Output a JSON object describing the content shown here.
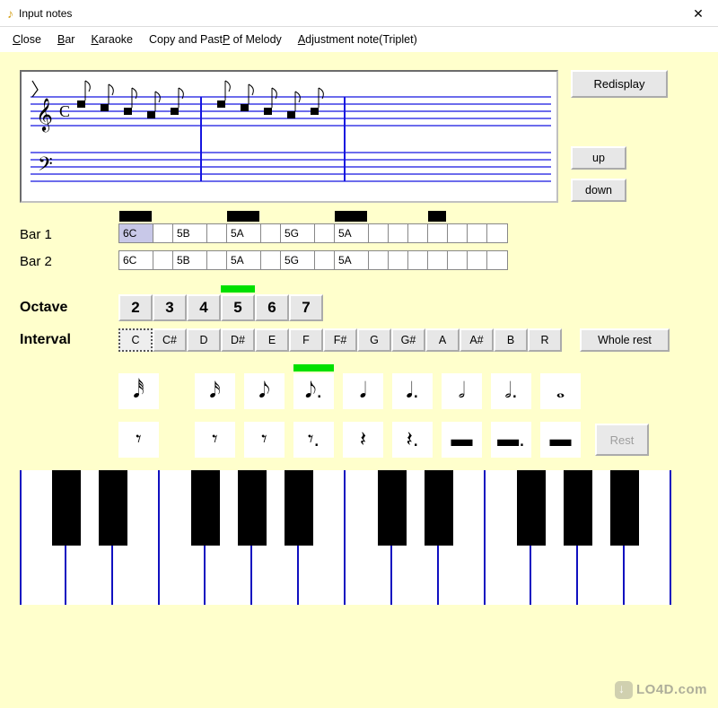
{
  "window": {
    "title": "Input notes",
    "close_glyph": "✕"
  },
  "menu": {
    "close": "Close",
    "bar": "Bar",
    "karaoke": "Karaoke",
    "copy": "Copy and Paste of Melody",
    "adjust": "Adjustment note(Triplet)"
  },
  "buttons": {
    "redisplay": "Redisplay",
    "up": "up",
    "down": "down",
    "rest": "Rest",
    "whole_rest": "Whole rest"
  },
  "bar_labels": {
    "b1": "Bar 1",
    "b2": "Bar 2"
  },
  "bar1": [
    "6C",
    "",
    "5B",
    "",
    "5A",
    "",
    "5G",
    "",
    "5A",
    "",
    "",
    "",
    "",
    "",
    "",
    ""
  ],
  "bar1_selected_index": 0,
  "bar1_markers": [
    0,
    4,
    8,
    12
  ],
  "bar2": [
    "6C",
    "",
    "5B",
    "",
    "5A",
    "",
    "5G",
    "",
    "5A",
    "",
    "",
    "",
    "",
    "",
    "",
    ""
  ],
  "bar_cell_widths": [
    38,
    22,
    38,
    22,
    38,
    22,
    38,
    22,
    38,
    22,
    22,
    22,
    22,
    22,
    22,
    22
  ],
  "octave": {
    "label": "Octave",
    "values": [
      "2",
      "3",
      "4",
      "5",
      "6",
      "7"
    ],
    "selected_index": 3
  },
  "interval": {
    "label": "Interval",
    "values": [
      "C",
      "C#",
      "D",
      "D#",
      "E",
      "F",
      "F#",
      "G",
      "G#",
      "A",
      "A#",
      "B",
      "R"
    ],
    "selected_index": 0
  },
  "durations": {
    "selected_index": 3,
    "notes": [
      "𝅘𝅥𝅰",
      "𝅘𝅥𝅯",
      "𝅘𝅥𝅮",
      "𝅘𝅥𝅮.",
      "𝅘𝅥",
      "𝅘𝅥.",
      "𝅗𝅥",
      "𝅗𝅥.",
      "𝅝"
    ],
    "rests": [
      "𝄾",
      "𝄾",
      "𝄾",
      "𝄾.",
      "𝄽",
      "𝄽.",
      "▬",
      "▬.",
      "▬"
    ]
  },
  "piano": {
    "white_keys": 14,
    "black_pattern": [
      1,
      1,
      0,
      1,
      1,
      1,
      0,
      1,
      1,
      0,
      1,
      1,
      1,
      0
    ]
  },
  "watermark": "LO4D.com"
}
